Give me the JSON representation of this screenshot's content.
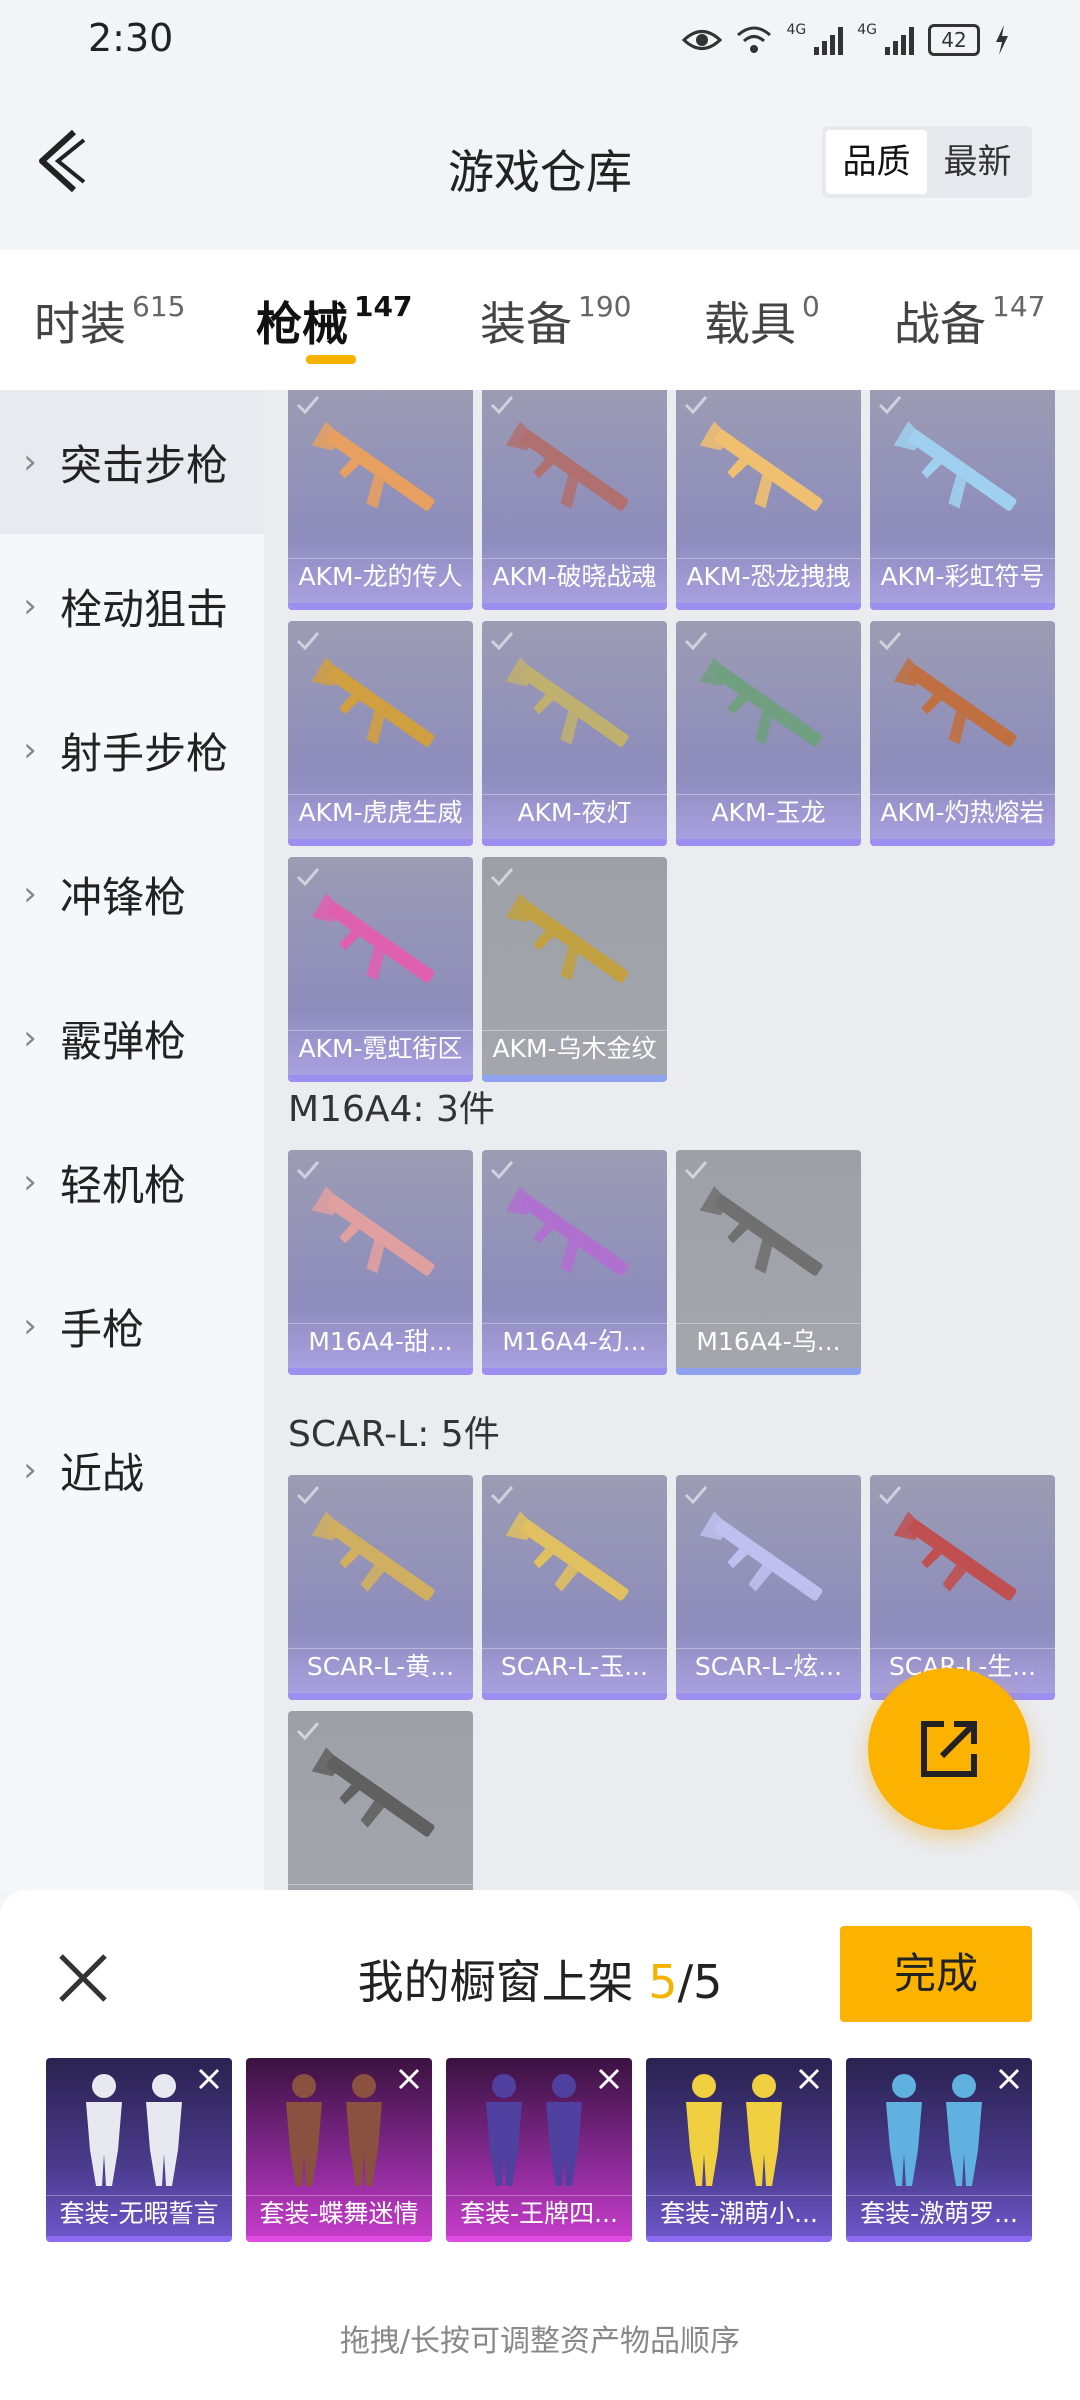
{
  "status_bar": {
    "time": "2:30",
    "battery": "42",
    "net1": "4G",
    "net2": "4G"
  },
  "header": {
    "title": "游戏仓库",
    "sort_options": [
      "品质",
      "最新"
    ]
  },
  "tabs": [
    {
      "label": "时装",
      "count": "615"
    },
    {
      "label": "枪械",
      "count": "147",
      "active": true
    },
    {
      "label": "装备",
      "count": "190"
    },
    {
      "label": "载具",
      "count": "0"
    },
    {
      "label": "战备",
      "count": "147"
    }
  ],
  "sidebar": {
    "items": [
      {
        "label": "突击步枪",
        "active": true
      },
      {
        "label": "栓动狙击"
      },
      {
        "label": "射手步枪"
      },
      {
        "label": "冲锋枪"
      },
      {
        "label": "霰弹枪"
      },
      {
        "label": "轻机枪"
      },
      {
        "label": "手枪"
      },
      {
        "label": "近战"
      }
    ]
  },
  "content": {
    "akm_items": [
      {
        "name": "AKM-龙的传人",
        "gun_color": "#e8a060"
      },
      {
        "name": "AKM-破晓战魂",
        "gun_color": "#b07070"
      },
      {
        "name": "AKM-恐龙拽拽",
        "gun_color": "#f0c070"
      },
      {
        "name": "AKM-彩虹符号",
        "gun_color": "#a0d0f0"
      },
      {
        "name": "AKM-虎虎生威",
        "gun_color": "#d0a040"
      },
      {
        "name": "AKM-夜灯",
        "gun_color": "#c0b070"
      },
      {
        "name": "AKM-玉龙",
        "gun_color": "#70a080"
      },
      {
        "name": "AKM-灼热熔岩",
        "gun_color": "#c07040"
      },
      {
        "name": "AKM-霓虹街区",
        "gun_color": "#e060b0"
      },
      {
        "name": "AKM-乌木金纹",
        "gun_color": "#c0a040",
        "gray": true
      }
    ],
    "m16_title": "M16A4: 3件",
    "m16_items": [
      {
        "name": "M16A4-甜...",
        "gun_color": "#e0a0a0"
      },
      {
        "name": "M16A4-幻...",
        "gun_color": "#b070d0"
      },
      {
        "name": "M16A4-乌...",
        "gun_color": "#707070",
        "gray": true
      }
    ],
    "scar_title": "SCAR-L: 5件",
    "scar_items": [
      {
        "name": "SCAR-L-黄...",
        "gun_color": "#d0b060"
      },
      {
        "name": "SCAR-L-玉...",
        "gun_color": "#e0c060"
      },
      {
        "name": "SCAR-L-炫...",
        "gun_color": "#c0c0f0"
      },
      {
        "name": "SCAR-L-生...",
        "gun_color": "#c05050"
      },
      {
        "name": "",
        "gun_color": "#606060",
        "gray": true
      }
    ]
  },
  "sheet": {
    "title_prefix": "我的橱窗上架 ",
    "count_current": "5",
    "count_sep": "/",
    "count_total": "5",
    "done_label": "完成",
    "outfits": [
      {
        "name": "套装-无暇誓言",
        "style": "purple",
        "figure_color": "#e8e8f0"
      },
      {
        "name": "套装-蝶舞迷情",
        "style": "magenta",
        "figure_color": "#8a5040"
      },
      {
        "name": "套装-王牌四...",
        "style": "magenta",
        "figure_color": "#5040a0"
      },
      {
        "name": "套装-潮萌小...",
        "style": "purple",
        "figure_color": "#f0d040"
      },
      {
        "name": "套装-激萌罗...",
        "style": "purple",
        "figure_color": "#60b0e0"
      }
    ],
    "hint": "拖拽/长按可调整资产物品顺序"
  }
}
